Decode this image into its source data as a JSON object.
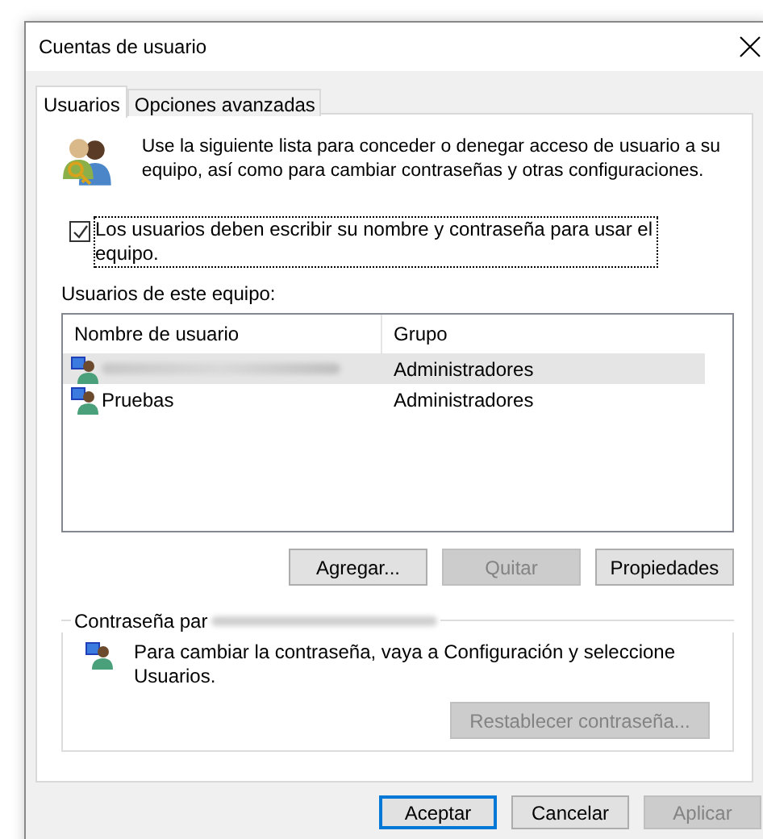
{
  "window": {
    "title": "Cuentas de usuario"
  },
  "tabs": [
    {
      "label": "Usuarios",
      "selected": true
    },
    {
      "label": "Opciones avanzadas",
      "selected": false
    }
  ],
  "intro": "Use la siguiente lista para conceder o denegar acceso de usuario a su equipo, así como para cambiar contraseñas y otras configuraciones.",
  "require_login": {
    "label": "Los usuarios deben escribir su nombre y contraseña para usar el equipo.",
    "checked": true
  },
  "users_label": "Usuarios de este equipo:",
  "table": {
    "columns": [
      "Nombre de usuario",
      "Grupo"
    ],
    "rows": [
      {
        "group": "Administradores",
        "selected": true
      },
      {
        "name": "Pruebas",
        "group": "Administradores",
        "selected": false
      }
    ]
  },
  "list_buttons": [
    {
      "label": "Agregar...",
      "disabled": false
    },
    {
      "label": "Quitar",
      "disabled": true
    },
    {
      "label": "Propiedades",
      "disabled": false
    }
  ],
  "password_group": {
    "title": "Contraseña par",
    "message": "Para cambiar la contraseña, vaya a Configuración y seleccione Usuarios.",
    "button": {
      "label": "Restablecer contraseña...",
      "disabled": true
    }
  },
  "dialog_buttons": [
    {
      "label": "Aceptar",
      "disabled": false,
      "default": true
    },
    {
      "label": "Cancelar",
      "disabled": false,
      "default": false
    },
    {
      "label": "Aplicar",
      "disabled": true,
      "default": false
    }
  ]
}
